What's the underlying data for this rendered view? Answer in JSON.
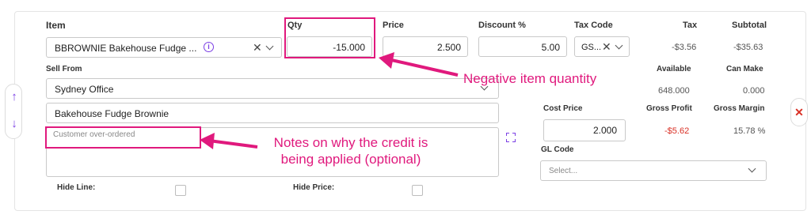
{
  "headers": {
    "item": "Item",
    "qty": "Qty",
    "price": "Price",
    "discount": "Discount %",
    "tax_code": "Tax Code",
    "tax": "Tax",
    "subtotal": "Subtotal"
  },
  "line": {
    "item_value": "BBROWNIE Bakehouse Fudge ...",
    "qty_value": "-15.000",
    "price_value": "2.500",
    "discount_value": "5.00",
    "tax_code_value": "GS...",
    "tax_value": "-$3.56",
    "subtotal_value": "-$35.63"
  },
  "sell_from": {
    "label": "Sell From",
    "value": "Sydney Office"
  },
  "stock": {
    "available_label": "Available",
    "can_make_label": "Can Make",
    "available_value": "648.000",
    "can_make_value": "0.000"
  },
  "description_value": "Bakehouse Fudge Brownie",
  "notes_placeholder": "Customer over-ordered",
  "cost": {
    "cost_price_label": "Cost Price",
    "gross_profit_label": "Gross Profit",
    "gross_margin_label": "Gross Margin",
    "cost_price_value": "2.000",
    "gross_profit_value": "-$5.62",
    "gross_margin_value": "15.78 %"
  },
  "gl_code": {
    "label": "GL Code",
    "placeholder": "Select..."
  },
  "toggles": {
    "hide_line": "Hide Line:",
    "hide_price": "Hide Price:"
  },
  "annotations": {
    "qty_note": "Negative item quantity",
    "notes_note_line1": "Notes on why the credit is",
    "notes_note_line2": "being applied (optional)"
  },
  "colors": {
    "annotation": "#e0197d",
    "negative_value": "#d93025",
    "accent_purple": "#7b3fe4",
    "remove_red": "#d93025"
  }
}
